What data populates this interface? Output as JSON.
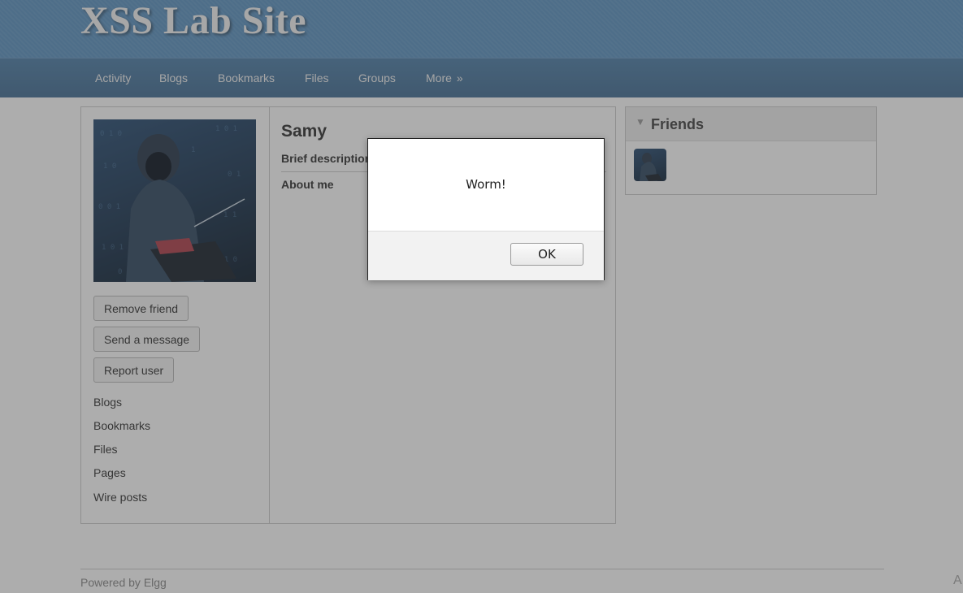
{
  "header": {
    "site_title": "XSS Lab Site"
  },
  "nav": {
    "items": [
      "Activity",
      "Blogs",
      "Bookmarks",
      "Files",
      "Groups"
    ],
    "more_label": "More",
    "more_arrow": "»"
  },
  "profile": {
    "name": "Samy",
    "fields": {
      "brief_description": "Brief description:",
      "about_me": "About me"
    },
    "actions": {
      "remove_friend": "Remove friend",
      "send_message": "Send a message",
      "report_user": "Report user"
    },
    "owner_links": [
      "Blogs",
      "Bookmarks",
      "Files",
      "Pages",
      "Wire posts"
    ]
  },
  "friends": {
    "title": "Friends",
    "caret": "▼"
  },
  "footer": {
    "powered_by": "Powered by Elgg",
    "corner_glyph": "A"
  },
  "dialog": {
    "message": "Worm!",
    "ok_label": "OK"
  },
  "colors": {
    "header_blue": "#5c93c2",
    "nav_blue": "#4f7fa8",
    "overlay": "rgba(60,60,60,0.42)"
  }
}
